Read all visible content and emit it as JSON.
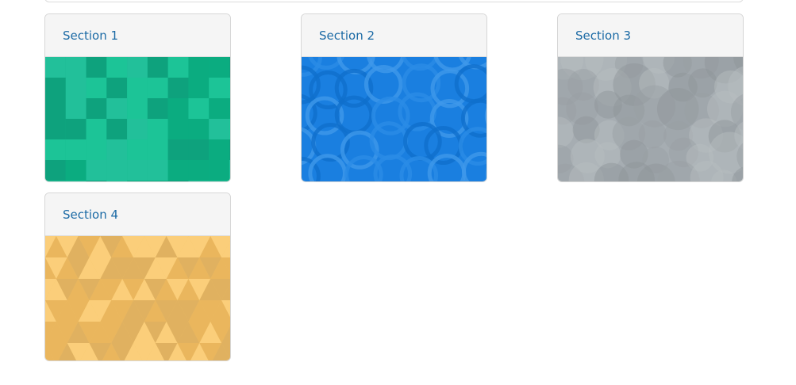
{
  "sections": [
    {
      "title": "Section 1",
      "pattern": "squares",
      "base_color": "#10b48a",
      "accent_colors": [
        "#0ea27d",
        "#1cc497",
        "#0bac80",
        "#22c09a"
      ]
    },
    {
      "title": "Section 2",
      "pattern": "rings",
      "base_color": "#1a7fe0",
      "accent_colors": [
        "#2b8ce6",
        "#0f6fcc",
        "#3f98ea"
      ]
    },
    {
      "title": "Section 3",
      "pattern": "circles",
      "base_color": "#a6adb2",
      "accent_colors": [
        "#8e9499",
        "#b8bec2",
        "#9aa0a5"
      ]
    },
    {
      "title": "Section 4",
      "pattern": "triangles",
      "base_color": "#f5c46b",
      "accent_colors": [
        "#e8b45a",
        "#fbd07c",
        "#dcae5e"
      ]
    }
  ]
}
